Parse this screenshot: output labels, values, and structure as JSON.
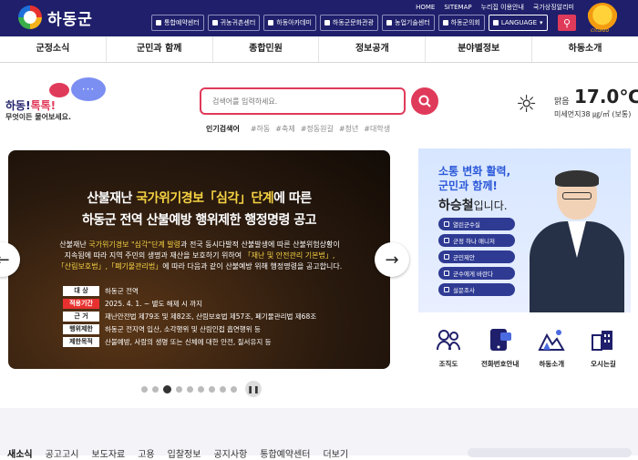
{
  "header": {
    "site_name": "하동군",
    "utils": [
      "HOME",
      "SITEMAP",
      "누리집 이용안내",
      "국가상징알리미"
    ],
    "quick_links": [
      "통합예약센터",
      "귀농귀촌센터",
      "하동아카데미",
      "하동군문화관광",
      "농업기술센터",
      "하동군의회",
      "LANGUAGE"
    ],
    "mascot_text": "cituloo"
  },
  "gnb": [
    "군정소식",
    "군민과 함께",
    "종합민원",
    "정보공개",
    "분야별정보",
    "하동소개"
  ],
  "talk": {
    "title_a": "하동!",
    "title_b": "톡톡!",
    "sub": "무엇이든 물어보세요.",
    "bubble": "···"
  },
  "search": {
    "placeholder": "검색어를 입력하세요.",
    "popular_label": "인기검색어",
    "popular": [
      "#하동",
      "#축제",
      "#정동원길",
      "#청년",
      "#대학생"
    ]
  },
  "weather": {
    "desc": "맑음",
    "temp": "17.0℃",
    "dust": "미세먼지38 ㎍/㎥ (보통)"
  },
  "slide": {
    "h1_a": "산불재난 ",
    "h1_b": "국가위기경보「심각」단계",
    "h1_c": "에 따른",
    "h2": "하동군 전역 산불예방 행위제한 행정명령 공고",
    "body1_a": "산불재난 ",
    "body1_b": "국가위기경보 \"심각\"단계 발령",
    "body1_c": "과 전국 동시다발적 산불발생에 따른 산불위험상황이",
    "body2_a": "지속됨에 따라 지역 주민의 생명과 재산을 보호하기 위하여 ",
    "body2_b": "「재난 및 안전관리 기본법」,",
    "body3_a": "「산림보호법」,「폐기물관리법」",
    "body3_b": "에 따라 다음과 같이 산불예방 위해 행정명령을 공고합니다.",
    "rows": [
      {
        "k": "대    상",
        "v": "하동군 전역"
      },
      {
        "k": "적용기간",
        "v": "2025. 4. 1. ~ 별도 해제 시 까지"
      },
      {
        "k": "근    거",
        "v": "재난안전법 제79조 및 제82조, 산림보호법 제57조, 폐기물관리법 제68조"
      },
      {
        "k": "행위제한",
        "v": "하동군 전지역 입산, 소각행위 및 산림인접 흡연행위 등"
      },
      {
        "k": "제한목적",
        "v": "산불예방, 사람의 생명 또는 신체에 대한 안전, 질서유지 등"
      }
    ],
    "prev_icon": "←",
    "next_icon": "→",
    "pause_icon": "❚❚"
  },
  "promo": {
    "line1": "소통 변화 활력,",
    "line2": "군민과 함께!",
    "name": "하승철",
    "suffix": "입니다.",
    "links": [
      "열린군수실",
      "군정 하나 매니저",
      "군민제안",
      "군수에게 바란다",
      "설문조사"
    ]
  },
  "quick_icons": [
    {
      "label": "조직도",
      "icon": "org-chart-icon"
    },
    {
      "label": "전화번호안내",
      "icon": "phone-icon"
    },
    {
      "label": "하동소개",
      "icon": "landscape-icon"
    },
    {
      "label": "오시는길",
      "icon": "building-icon"
    }
  ],
  "bottom_tabs": [
    "새소식",
    "공고고시",
    "보도자료",
    "고용",
    "입찰정보",
    "공지사항",
    "통합예약센터",
    "더보기"
  ]
}
